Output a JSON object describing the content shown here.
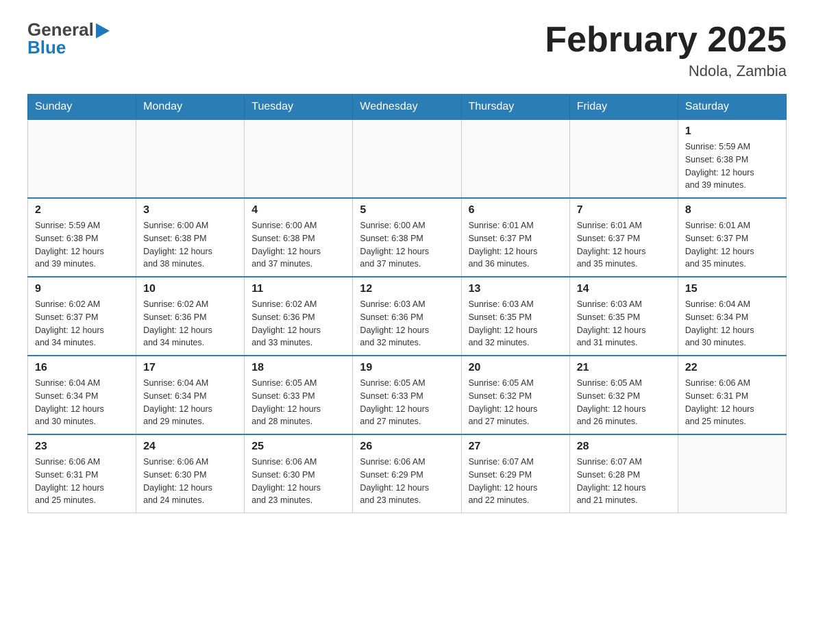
{
  "header": {
    "logo_line1": "General",
    "logo_line2": "Blue",
    "month_title": "February 2025",
    "location": "Ndola, Zambia"
  },
  "days_of_week": [
    "Sunday",
    "Monday",
    "Tuesday",
    "Wednesday",
    "Thursday",
    "Friday",
    "Saturday"
  ],
  "weeks": [
    [
      {
        "day": "",
        "info": ""
      },
      {
        "day": "",
        "info": ""
      },
      {
        "day": "",
        "info": ""
      },
      {
        "day": "",
        "info": ""
      },
      {
        "day": "",
        "info": ""
      },
      {
        "day": "",
        "info": ""
      },
      {
        "day": "1",
        "info": "Sunrise: 5:59 AM\nSunset: 6:38 PM\nDaylight: 12 hours\nand 39 minutes."
      }
    ],
    [
      {
        "day": "2",
        "info": "Sunrise: 5:59 AM\nSunset: 6:38 PM\nDaylight: 12 hours\nand 39 minutes."
      },
      {
        "day": "3",
        "info": "Sunrise: 6:00 AM\nSunset: 6:38 PM\nDaylight: 12 hours\nand 38 minutes."
      },
      {
        "day": "4",
        "info": "Sunrise: 6:00 AM\nSunset: 6:38 PM\nDaylight: 12 hours\nand 37 minutes."
      },
      {
        "day": "5",
        "info": "Sunrise: 6:00 AM\nSunset: 6:38 PM\nDaylight: 12 hours\nand 37 minutes."
      },
      {
        "day": "6",
        "info": "Sunrise: 6:01 AM\nSunset: 6:37 PM\nDaylight: 12 hours\nand 36 minutes."
      },
      {
        "day": "7",
        "info": "Sunrise: 6:01 AM\nSunset: 6:37 PM\nDaylight: 12 hours\nand 35 minutes."
      },
      {
        "day": "8",
        "info": "Sunrise: 6:01 AM\nSunset: 6:37 PM\nDaylight: 12 hours\nand 35 minutes."
      }
    ],
    [
      {
        "day": "9",
        "info": "Sunrise: 6:02 AM\nSunset: 6:37 PM\nDaylight: 12 hours\nand 34 minutes."
      },
      {
        "day": "10",
        "info": "Sunrise: 6:02 AM\nSunset: 6:36 PM\nDaylight: 12 hours\nand 34 minutes."
      },
      {
        "day": "11",
        "info": "Sunrise: 6:02 AM\nSunset: 6:36 PM\nDaylight: 12 hours\nand 33 minutes."
      },
      {
        "day": "12",
        "info": "Sunrise: 6:03 AM\nSunset: 6:36 PM\nDaylight: 12 hours\nand 32 minutes."
      },
      {
        "day": "13",
        "info": "Sunrise: 6:03 AM\nSunset: 6:35 PM\nDaylight: 12 hours\nand 32 minutes."
      },
      {
        "day": "14",
        "info": "Sunrise: 6:03 AM\nSunset: 6:35 PM\nDaylight: 12 hours\nand 31 minutes."
      },
      {
        "day": "15",
        "info": "Sunrise: 6:04 AM\nSunset: 6:34 PM\nDaylight: 12 hours\nand 30 minutes."
      }
    ],
    [
      {
        "day": "16",
        "info": "Sunrise: 6:04 AM\nSunset: 6:34 PM\nDaylight: 12 hours\nand 30 minutes."
      },
      {
        "day": "17",
        "info": "Sunrise: 6:04 AM\nSunset: 6:34 PM\nDaylight: 12 hours\nand 29 minutes."
      },
      {
        "day": "18",
        "info": "Sunrise: 6:05 AM\nSunset: 6:33 PM\nDaylight: 12 hours\nand 28 minutes."
      },
      {
        "day": "19",
        "info": "Sunrise: 6:05 AM\nSunset: 6:33 PM\nDaylight: 12 hours\nand 27 minutes."
      },
      {
        "day": "20",
        "info": "Sunrise: 6:05 AM\nSunset: 6:32 PM\nDaylight: 12 hours\nand 27 minutes."
      },
      {
        "day": "21",
        "info": "Sunrise: 6:05 AM\nSunset: 6:32 PM\nDaylight: 12 hours\nand 26 minutes."
      },
      {
        "day": "22",
        "info": "Sunrise: 6:06 AM\nSunset: 6:31 PM\nDaylight: 12 hours\nand 25 minutes."
      }
    ],
    [
      {
        "day": "23",
        "info": "Sunrise: 6:06 AM\nSunset: 6:31 PM\nDaylight: 12 hours\nand 25 minutes."
      },
      {
        "day": "24",
        "info": "Sunrise: 6:06 AM\nSunset: 6:30 PM\nDaylight: 12 hours\nand 24 minutes."
      },
      {
        "day": "25",
        "info": "Sunrise: 6:06 AM\nSunset: 6:30 PM\nDaylight: 12 hours\nand 23 minutes."
      },
      {
        "day": "26",
        "info": "Sunrise: 6:06 AM\nSunset: 6:29 PM\nDaylight: 12 hours\nand 23 minutes."
      },
      {
        "day": "27",
        "info": "Sunrise: 6:07 AM\nSunset: 6:29 PM\nDaylight: 12 hours\nand 22 minutes."
      },
      {
        "day": "28",
        "info": "Sunrise: 6:07 AM\nSunset: 6:28 PM\nDaylight: 12 hours\nand 21 minutes."
      },
      {
        "day": "",
        "info": ""
      }
    ]
  ]
}
